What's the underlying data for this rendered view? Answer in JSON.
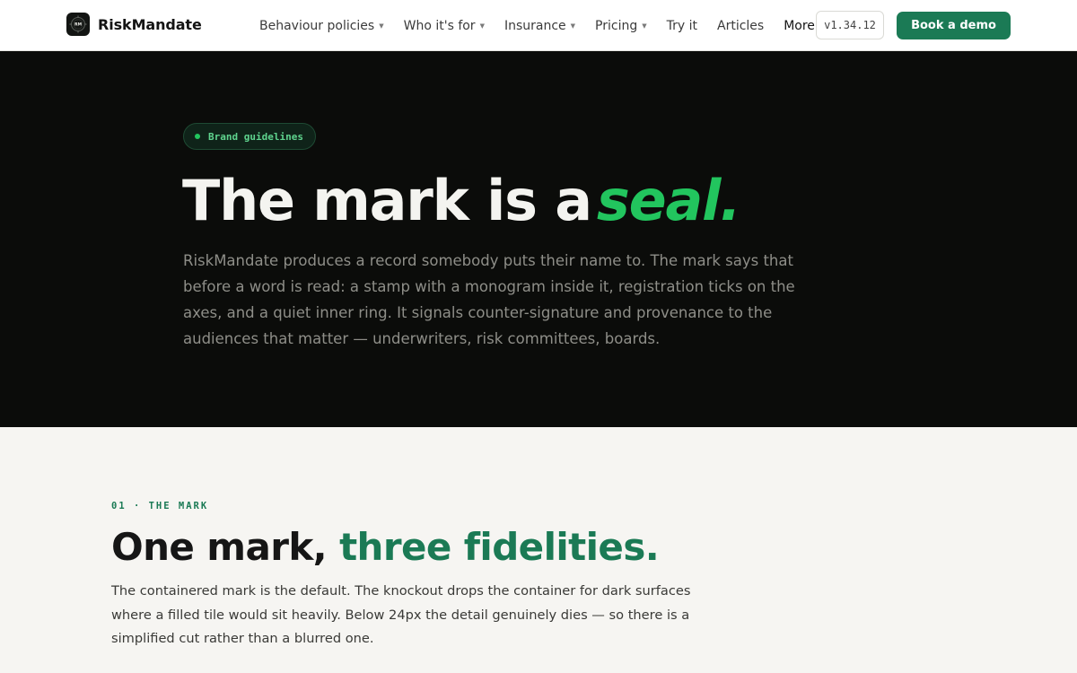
{
  "nav": {
    "brand_name": "RiskMandate",
    "logo_monogram": "RM",
    "items": [
      {
        "label": "Behaviour policies",
        "has_caret": true
      },
      {
        "label": "Who it's for",
        "has_caret": true
      },
      {
        "label": "Insurance",
        "has_caret": true
      },
      {
        "label": "Pricing",
        "has_caret": true
      },
      {
        "label": "Try it",
        "has_caret": false
      },
      {
        "label": "Articles",
        "has_caret": false
      },
      {
        "label": "More",
        "has_caret": true
      }
    ],
    "caret_icon": "chevron-down-icon",
    "version": "v1.34.12",
    "cta_label": "Book a demo"
  },
  "hero": {
    "badge": "Brand guidelines",
    "title_main": "The mark is a",
    "title_accent": "seal.",
    "body": "RiskMandate produces a record somebody puts their name to. The mark says that before a word is read: a stamp with a monogram inside it, registration ticks on the axes, and a quiet inner ring. It signals counter-signature and provenance to the audiences that matter — underwriters, risk committees, boards."
  },
  "section": {
    "eyebrow": "01 · THE MARK",
    "title_main": "One mark,",
    "title_accent": "three fidelities.",
    "body": "The containered mark is the default. The knockout drops the container for dark surfaces where a filled tile would sit heavily. Below 24px the detail genuinely dies — so there is a simplified cut rather than a blurred one."
  },
  "colors": {
    "brand_green": "#1b7a55",
    "accent_green": "#22c55e",
    "hero_bg": "#0b0c0a",
    "page_bg": "#f6f5f2"
  }
}
